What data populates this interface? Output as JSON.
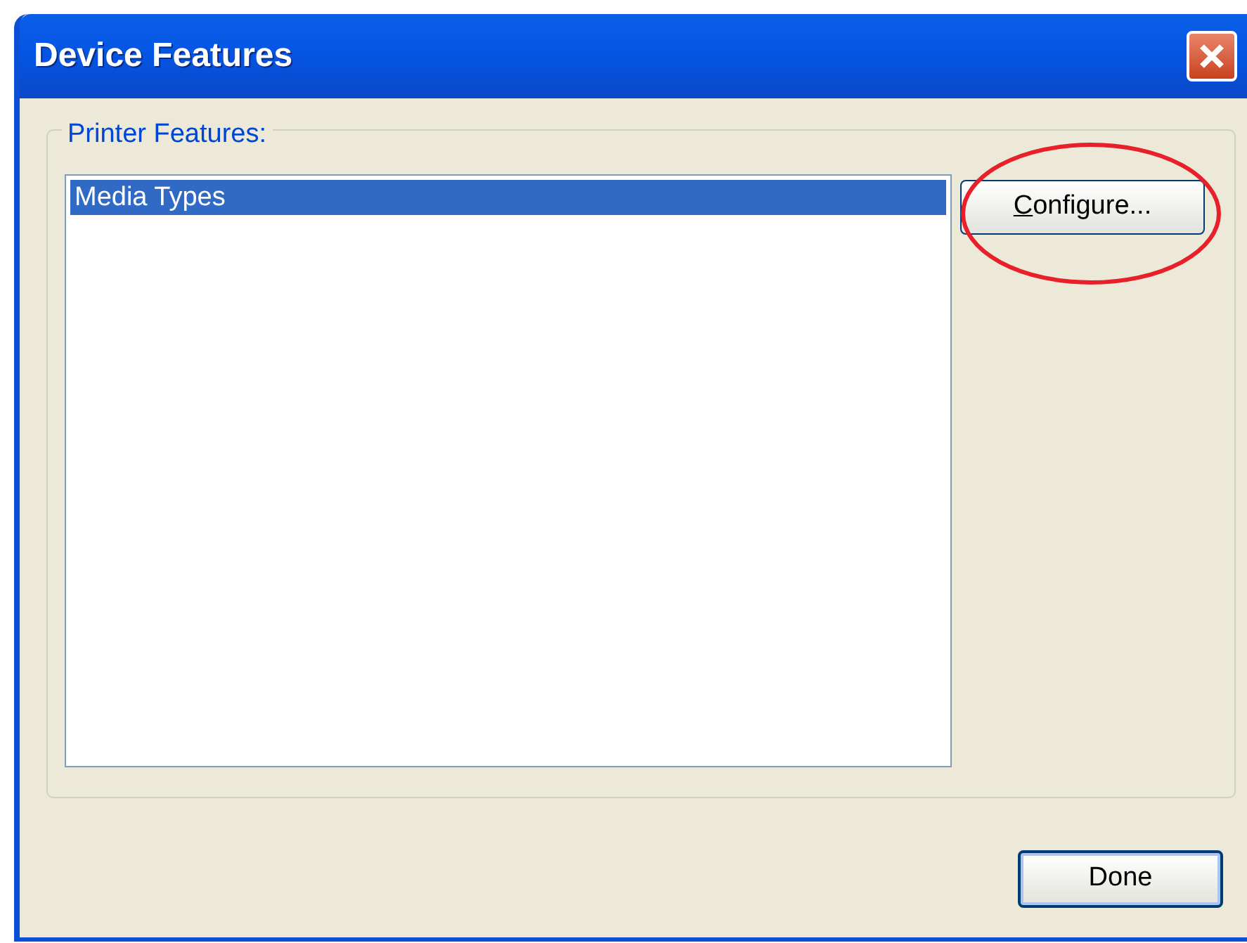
{
  "window": {
    "title": "Device Features"
  },
  "group": {
    "label": "Printer Features:"
  },
  "list": {
    "items": [
      {
        "label": "Media Types",
        "selected": true
      }
    ]
  },
  "buttons": [
    {
      "label": "Configure...",
      "first_letter_underlined": true,
      "highlighted": true
    },
    {
      "label": "Done",
      "default": true
    }
  ]
}
